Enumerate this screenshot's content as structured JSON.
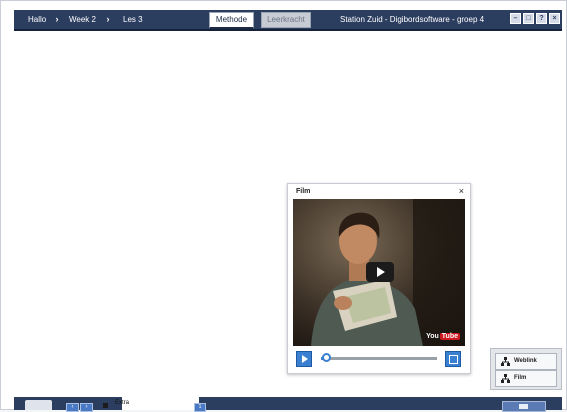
{
  "breadcrumb": {
    "items": [
      "Hallo",
      "Week 2",
      "Les 3"
    ],
    "separator": "›"
  },
  "tabs": [
    {
      "label": "Methode",
      "state": "active"
    },
    {
      "label": "Leerkracht",
      "state": "inactive"
    }
  ],
  "app_title": "Station Zuid - Digibordsoftware - groep 4",
  "window_buttons": [
    "minimize-icon",
    "restore-icon",
    "help-icon",
    "close-icon"
  ],
  "film_panel": {
    "title": "Film",
    "close_symbol": "×",
    "video_brand": {
      "you": "You",
      "tube": "Tube"
    },
    "progress": 0.05
  },
  "media_links": [
    {
      "label": "Weblink",
      "icon": "network-icon"
    },
    {
      "label": "Film",
      "icon": "network-icon"
    }
  ],
  "bottom_bar": {
    "extra_label": "Extra"
  },
  "colors": {
    "bar": "#2c3e60",
    "accent": "#3a7fd0",
    "youtube_red": "#cc181e"
  }
}
